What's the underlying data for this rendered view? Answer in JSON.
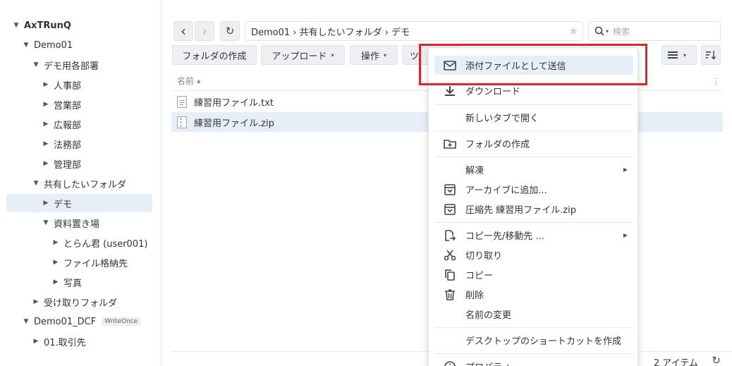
{
  "sidebar": {
    "items": [
      {
        "label": "AxTRunQ",
        "arrow": "▼"
      },
      {
        "label": "Demo01",
        "arrow": "▼"
      },
      {
        "label": "デモ用各部署",
        "arrow": "▼"
      },
      {
        "label": "人事部",
        "arrow": "▶"
      },
      {
        "label": "営業部",
        "arrow": "▶"
      },
      {
        "label": "広報部",
        "arrow": "▶"
      },
      {
        "label": "法務部",
        "arrow": "▶"
      },
      {
        "label": "管理部",
        "arrow": "▶"
      },
      {
        "label": "共有したいフォルダ",
        "arrow": "▼"
      },
      {
        "label": "デモ",
        "arrow": "▶"
      },
      {
        "label": "資料置き場",
        "arrow": "▼"
      },
      {
        "label": "とらん君 (user001)",
        "arrow": "▶"
      },
      {
        "label": "ファイル格納先",
        "arrow": "▶"
      },
      {
        "label": "写真",
        "arrow": "▶"
      },
      {
        "label": "受け取りフォルダ",
        "arrow": "▶"
      },
      {
        "label": "Demo01_DCF",
        "arrow": "▼",
        "badge": "WriteOnce"
      },
      {
        "label": "01.取引先",
        "arrow": "▶"
      }
    ]
  },
  "toolbar": {
    "back": "‹",
    "forward": "›",
    "refresh": "↻",
    "path": "Demo01 › 共有したいフォルダ › デモ",
    "star": "★",
    "search_placeholder": "検索",
    "create_folder": "フォルダの作成",
    "upload": "アップロード",
    "action": "操作",
    "tools_partial": "ツ",
    "caret": "▾"
  },
  "list": {
    "column_name": "名前",
    "sort_indicator": "▲",
    "more": "⋮",
    "files": [
      {
        "name": "練習用ファイル.txt",
        "type": "txt"
      },
      {
        "name": "練習用ファイル.zip",
        "type": "zip"
      }
    ]
  },
  "status": {
    "count": "2 アイテム",
    "refresh": "↻"
  },
  "context_menu": {
    "items": [
      {
        "label": "添付ファイルとして送信",
        "icon": "mail-icon"
      },
      {
        "label": "ダウンロード",
        "icon": "download-icon"
      },
      {
        "label": "新しいタブで開く",
        "icon": ""
      },
      {
        "label": "フォルダの作成",
        "icon": "folder-plus-icon"
      },
      {
        "label": "解凍",
        "icon": "",
        "submenu": true
      },
      {
        "label": "アーカイブに追加...",
        "icon": "archive-icon"
      },
      {
        "label": "圧縮先 練習用ファイル.zip",
        "icon": "archive-icon"
      },
      {
        "label": "コピー先/移動先 ...",
        "icon": "copy-move-icon",
        "submenu": true
      },
      {
        "label": "切り取り",
        "icon": "scissors-icon"
      },
      {
        "label": "コピー",
        "icon": "copy-icon"
      },
      {
        "label": "削除",
        "icon": "trash-icon"
      },
      {
        "label": "名前の変更",
        "icon": ""
      },
      {
        "label": "デスクトップのショートカットを作成",
        "icon": ""
      },
      {
        "label": "プロパティ",
        "icon": "info-icon"
      }
    ]
  },
  "colors": {
    "selection": "#e6eef7",
    "highlight_border": "#d9262a",
    "app_icon": "#f3a21a"
  }
}
